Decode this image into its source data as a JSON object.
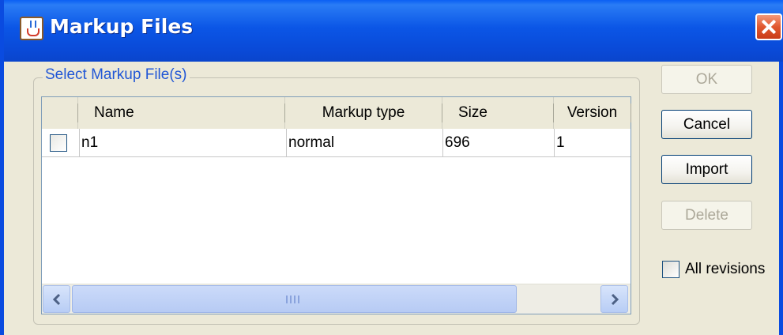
{
  "window": {
    "title": "Markup Files"
  },
  "icons": {
    "app": "java-cup-icon",
    "close": "close-icon",
    "scroll_left": "arrow-left-icon",
    "scroll_right": "arrow-right-icon"
  },
  "group": {
    "label": "Select Markup File(s)"
  },
  "table": {
    "columns": [
      "",
      "Name",
      "Markup type",
      "Size",
      "Version"
    ],
    "rows": [
      {
        "checked": false,
        "name": "n1",
        "markup_type": "normal",
        "size": "696",
        "version": "1"
      }
    ]
  },
  "buttons": {
    "ok": "OK",
    "cancel": "Cancel",
    "import": "Import",
    "delete": "Delete"
  },
  "options": {
    "all_revisions_label": "All revisions",
    "all_revisions_checked": false
  },
  "colors": {
    "title_bar": "#0a4be0",
    "group_label": "#2157d6",
    "window_bg": "#ece9d8",
    "close_button": "#e1582f"
  }
}
